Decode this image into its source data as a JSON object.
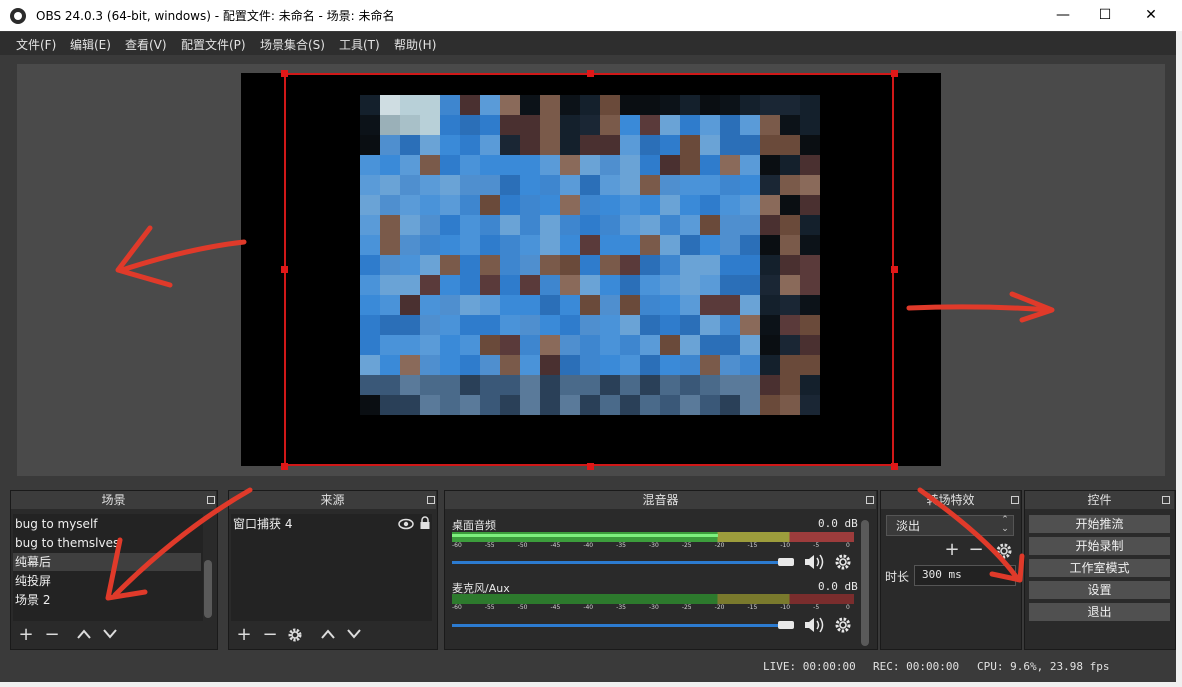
{
  "window": {
    "title": "OBS 24.0.3 (64-bit, windows) - 配置文件: 未命名 - 场景: 未命名",
    "minimize": "—",
    "maximize": "☐",
    "close": "✕"
  },
  "menu": [
    "文件(F)",
    "编辑(E)",
    "查看(V)",
    "配置文件(P)",
    "场景集合(S)",
    "工具(T)",
    "帮助(H)"
  ],
  "scenes": {
    "header": "场景",
    "items": [
      "bug to myself",
      "bug to themslves",
      "纯幕后",
      "纯投屏",
      "场景 2"
    ],
    "selected_index": 2
  },
  "sources": {
    "header": "来源",
    "items": [
      "窗口捕获 4"
    ]
  },
  "mixer": {
    "header": "混音器",
    "scale_labels": [
      "-60",
      "-55",
      "-50",
      "-45",
      "-40",
      "-35",
      "-30",
      "-25",
      "-20",
      "-15",
      "-10",
      "-5",
      "0"
    ],
    "channels": [
      {
        "name": "桌面音频",
        "level": "0.0 dB",
        "volume": 1.0
      },
      {
        "name": "麦克风/Aux",
        "level": "0.0 dB",
        "volume": 1.0
      }
    ]
  },
  "transitions": {
    "header": "转场特效",
    "selected": "淡出",
    "duration_label": "时长",
    "duration_value": "300 ms"
  },
  "controls": {
    "header": "控件",
    "buttons": [
      "开始推流",
      "开始录制",
      "工作室模式",
      "设置",
      "退出"
    ]
  },
  "status": {
    "live": "LIVE: 00:00:00",
    "rec": "REC: 00:00:00",
    "cpu": "CPU: 9.6%, 23.98 fps"
  },
  "colors": {
    "selection": "#d01818",
    "annotation": "#e03a2a",
    "accent": "#2c7bd0"
  },
  "icons": [
    "obs-logo-icon",
    "plus-icon",
    "minus-icon",
    "chevron-up-icon",
    "chevron-down-icon",
    "gear-icon",
    "eye-icon",
    "lock-icon",
    "speaker-icon"
  ]
}
